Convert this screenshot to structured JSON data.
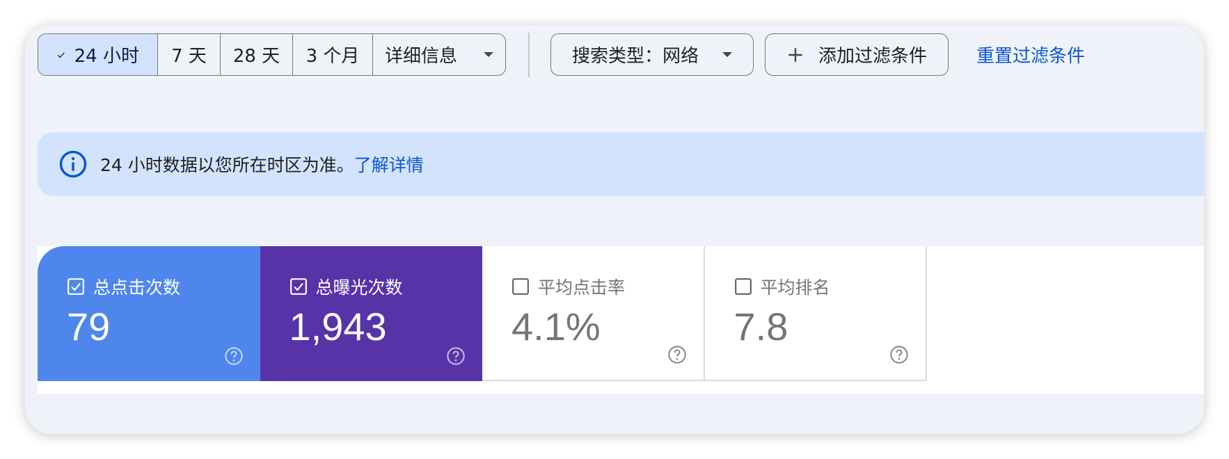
{
  "toolbar": {
    "date_ranges": [
      {
        "label": "24 小时",
        "selected": true
      },
      {
        "label": "7 天",
        "selected": false
      },
      {
        "label": "28 天",
        "selected": false
      },
      {
        "label": "3 个月",
        "selected": false
      },
      {
        "label": "详细信息",
        "selected": false
      }
    ],
    "search_type_label": "搜索类型：网络",
    "add_filter_label": "添加过滤条件",
    "reset_filters_label": "重置过滤条件"
  },
  "banner": {
    "text": "24 小时数据以您所在时区为准。",
    "link": "了解详情"
  },
  "metrics": [
    {
      "label": "总点击次数",
      "value": "79",
      "checked": true,
      "color": "#4f86ec"
    },
    {
      "label": "总曝光次数",
      "value": "1,943",
      "checked": true,
      "color": "#5733a8"
    },
    {
      "label": "平均点击率",
      "value": "4.1%",
      "checked": false
    },
    {
      "label": "平均排名",
      "value": "7.8",
      "checked": false
    }
  ],
  "colors": {
    "accent": "#0b57d0",
    "selected_segment": "#d3e3fd",
    "banner_bg": "#d3e3fd",
    "page_bg": "#eff3f9"
  }
}
